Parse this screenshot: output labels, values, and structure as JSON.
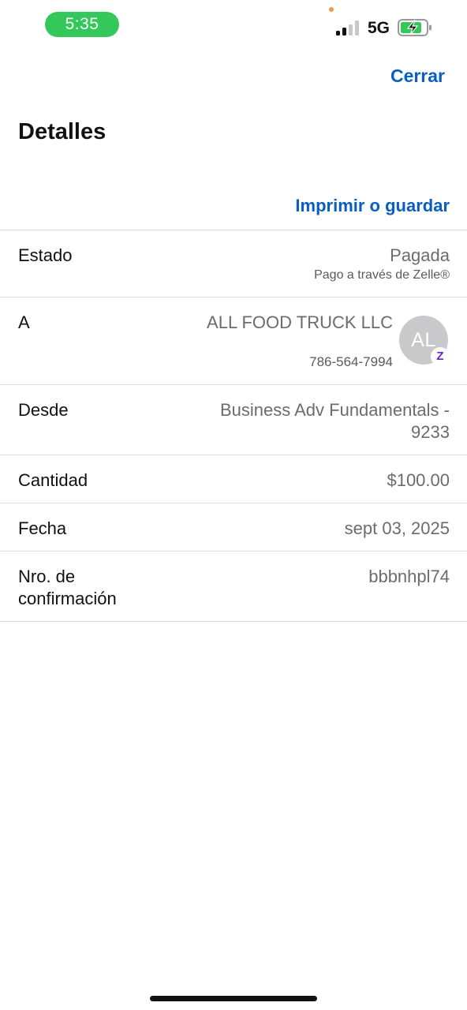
{
  "status_bar": {
    "time": "5:35",
    "network": "5G",
    "time_pill_color": "#34c759",
    "signal_bars_active": 2,
    "signal_bars_total": 4,
    "battery_state": "charging",
    "icons": [
      "signal-icon",
      "battery-charging-icon"
    ]
  },
  "header": {
    "close_label": "Cerrar",
    "title": "Detalles",
    "print_label": "Imprimir o guardar",
    "accent_color": "#0a5ec0"
  },
  "details": {
    "estado": {
      "label": "Estado",
      "value": "Pagada",
      "sub": "Pago a través de Zelle®"
    },
    "recipient": {
      "label": "A",
      "name": "ALL FOOD TRUCK LLC",
      "phone": "786-564-7994",
      "avatar_initials": "AL",
      "badge_glyph": "Z",
      "badge_icon": "zelle-icon",
      "badge_color": "#6d1ed4"
    },
    "desde": {
      "label": "Desde",
      "value": "Business Adv Fundamentals - 9233"
    },
    "cantidad": {
      "label": "Cantidad",
      "value": "$100.00"
    },
    "fecha": {
      "label": "Fecha",
      "value": "sept 03, 2025"
    },
    "confirmacion": {
      "label": "Nro. de confirmación",
      "value": "bbbnhpl74"
    }
  }
}
